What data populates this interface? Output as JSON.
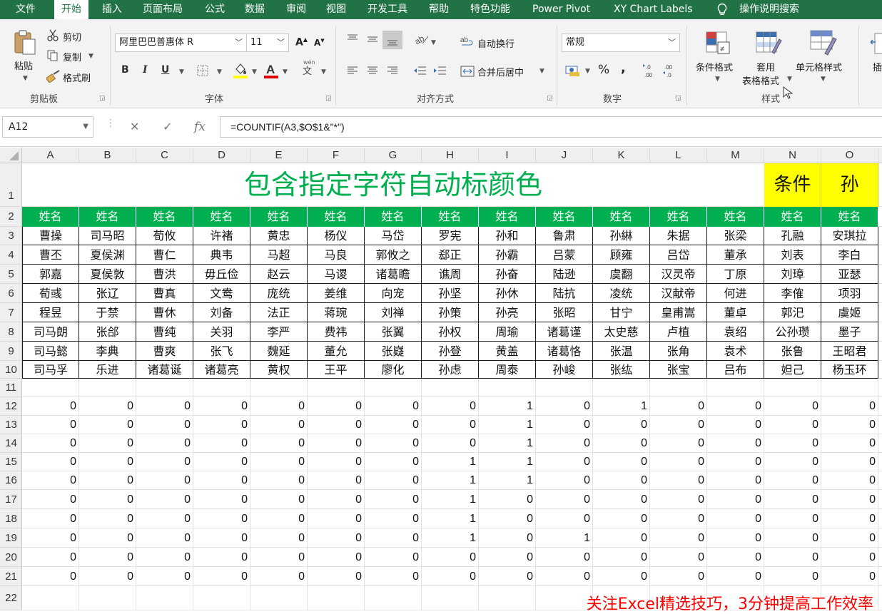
{
  "menu": {
    "tabs": [
      "文件",
      "开始",
      "插入",
      "页面布局",
      "公式",
      "数据",
      "审阅",
      "视图",
      "开发工具",
      "帮助",
      "特色功能",
      "Power Pivot",
      "XY Chart Labels"
    ],
    "active_index": 1,
    "tell_me": "操作说明搜索"
  },
  "ribbon": {
    "clipboard": {
      "label": "剪贴板",
      "paste": "粘贴",
      "cut": "剪切",
      "copy": "复制",
      "format_painter": "格式刷"
    },
    "font": {
      "label": "字体",
      "font_name": "阿里巴巴普惠体 R",
      "font_size": "11",
      "bold": "B",
      "italic": "I",
      "underline": "U",
      "wen": "文"
    },
    "alignment": {
      "label": "对齐方式",
      "wrap_text": "自动换行",
      "merge_center": "合并后居中"
    },
    "number": {
      "label": "数字",
      "format": "常规",
      "percent": "%",
      "comma": ","
    },
    "styles": {
      "label": "样式",
      "conditional_formatting": "条件格式",
      "format_as_table_1": "套用",
      "format_as_table_2": "表格格式",
      "cell_styles": "单元格样式",
      "insert": "插"
    }
  },
  "formula_bar": {
    "name_box": "A12",
    "formula": "=COUNTIF(A3,$O$1&\"*\")"
  },
  "sheet": {
    "columns": [
      "A",
      "B",
      "C",
      "D",
      "E",
      "F",
      "G",
      "H",
      "I",
      "J",
      "K",
      "L",
      "M",
      "N",
      "O"
    ],
    "row_numbers": [
      "1",
      "2",
      "3",
      "4",
      "5",
      "6",
      "7",
      "8",
      "9",
      "10",
      "11",
      "12",
      "13",
      "14",
      "15",
      "16",
      "17",
      "18",
      "19",
      "20",
      "21",
      "22"
    ],
    "title": "包含指定字符自动标颜色",
    "condition_label": "条件",
    "condition_value": "孙",
    "header_label": "姓名",
    "names": [
      [
        "曹操",
        "司马昭",
        "荀攸",
        "许褚",
        "黄忠",
        "杨仪",
        "马岱",
        "罗宪",
        "孙和",
        "鲁肃",
        "孙綝",
        "朱据",
        "张梁",
        "孔融",
        "安琪拉"
      ],
      [
        "曹丕",
        "夏侯渊",
        "曹仁",
        "典韦",
        "马超",
        "马良",
        "郭攸之",
        "郄正",
        "孙霸",
        "吕蒙",
        "顾雍",
        "吕岱",
        "董承",
        "刘表",
        "李白"
      ],
      [
        "郭嘉",
        "夏侯敦",
        "曹洪",
        "毋丘俭",
        "赵云",
        "马谡",
        "诸葛瞻",
        "谯周",
        "孙奋",
        "陆逊",
        "虞翻",
        "汉灵帝",
        "丁原",
        "刘璋",
        "亚瑟"
      ],
      [
        "荀彧",
        "张辽",
        "曹真",
        "文鸯",
        "庞统",
        "姜维",
        "向宠",
        "孙坚",
        "孙休",
        "陆抗",
        "凌统",
        "汉献帝",
        "何进",
        "李傕",
        "项羽"
      ],
      [
        "程昱",
        "于禁",
        "曹休",
        "刘备",
        "法正",
        "蒋琬",
        "刘禅",
        "孙策",
        "孙亮",
        "张昭",
        "甘宁",
        "皇甫嵩",
        "董卓",
        "郭汜",
        "虞姬"
      ],
      [
        "司马朗",
        "张郃",
        "曹纯",
        "关羽",
        "李严",
        "费祎",
        "张翼",
        "孙权",
        "周瑜",
        "诸葛谨",
        "太史慈",
        "卢植",
        "袁绍",
        "公孙瓒",
        "墨子"
      ],
      [
        "司马懿",
        "李典",
        "曹爽",
        "张飞",
        "魏延",
        "董允",
        "张嶷",
        "孙登",
        "黄盖",
        "诸葛恪",
        "张温",
        "张角",
        "袁术",
        "张鲁",
        "王昭君"
      ],
      [
        "司马孚",
        "乐进",
        "诸葛诞",
        "诸葛亮",
        "黄权",
        "王平",
        "廖化",
        "孙虑",
        "周泰",
        "孙峻",
        "张纮",
        "张宝",
        "吕布",
        "妲己",
        "杨玉环"
      ]
    ],
    "counts": [
      [
        "0",
        "0",
        "0",
        "0",
        "0",
        "0",
        "0",
        "0",
        "1",
        "0",
        "1",
        "0",
        "0",
        "0",
        "0"
      ],
      [
        "0",
        "0",
        "0",
        "0",
        "0",
        "0",
        "0",
        "0",
        "1",
        "0",
        "0",
        "0",
        "0",
        "0",
        "0"
      ],
      [
        "0",
        "0",
        "0",
        "0",
        "0",
        "0",
        "0",
        "0",
        "1",
        "0",
        "0",
        "0",
        "0",
        "0",
        "0"
      ],
      [
        "0",
        "0",
        "0",
        "0",
        "0",
        "0",
        "0",
        "1",
        "1",
        "0",
        "0",
        "0",
        "0",
        "0",
        "0"
      ],
      [
        "0",
        "0",
        "0",
        "0",
        "0",
        "0",
        "0",
        "1",
        "1",
        "0",
        "0",
        "0",
        "0",
        "0",
        "0"
      ],
      [
        "0",
        "0",
        "0",
        "0",
        "0",
        "0",
        "0",
        "1",
        "0",
        "0",
        "0",
        "0",
        "0",
        "0",
        "0"
      ],
      [
        "0",
        "0",
        "0",
        "0",
        "0",
        "0",
        "0",
        "1",
        "0",
        "0",
        "0",
        "0",
        "0",
        "0",
        "0"
      ],
      [
        "0",
        "0",
        "0",
        "0",
        "0",
        "0",
        "0",
        "1",
        "0",
        "1",
        "0",
        "0",
        "0",
        "0",
        "0"
      ],
      [
        "0",
        "0",
        "0",
        "0",
        "0",
        "0",
        "0",
        "0",
        "0",
        "0",
        "0",
        "0",
        "0",
        "0",
        "0"
      ],
      [
        "0",
        "0",
        "0",
        "0",
        "0",
        "0",
        "0",
        "0",
        "0",
        "0",
        "0",
        "0",
        "0",
        "0",
        "0"
      ]
    ],
    "footer_note": "关注Excel精选技巧，3分钟提高工作效率"
  },
  "colors": {
    "excel_green": "#217346",
    "header_fill": "#00b050",
    "title_green": "#00b050",
    "condition_fill": "#ffff00",
    "note_red": "#ff0000"
  }
}
